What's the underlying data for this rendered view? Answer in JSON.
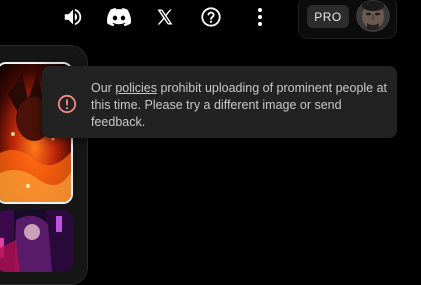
{
  "header": {
    "icons": [
      "speaker-icon",
      "discord-icon",
      "x-icon",
      "help-icon",
      "more-vert-icon"
    ],
    "pro_label": "PRO"
  },
  "toast": {
    "text_before": "Our ",
    "link_text": "policies",
    "text_after": " prohibit uploading of prominent people at this time. Please try a different image or send feedback.",
    "icon": "alert-circle-icon",
    "icon_color": "#f28b82"
  },
  "colors": {
    "background": "#000000",
    "toast_background": "#222222",
    "text": "#c8c8c8",
    "pro_badge": "#2c2c2c"
  }
}
